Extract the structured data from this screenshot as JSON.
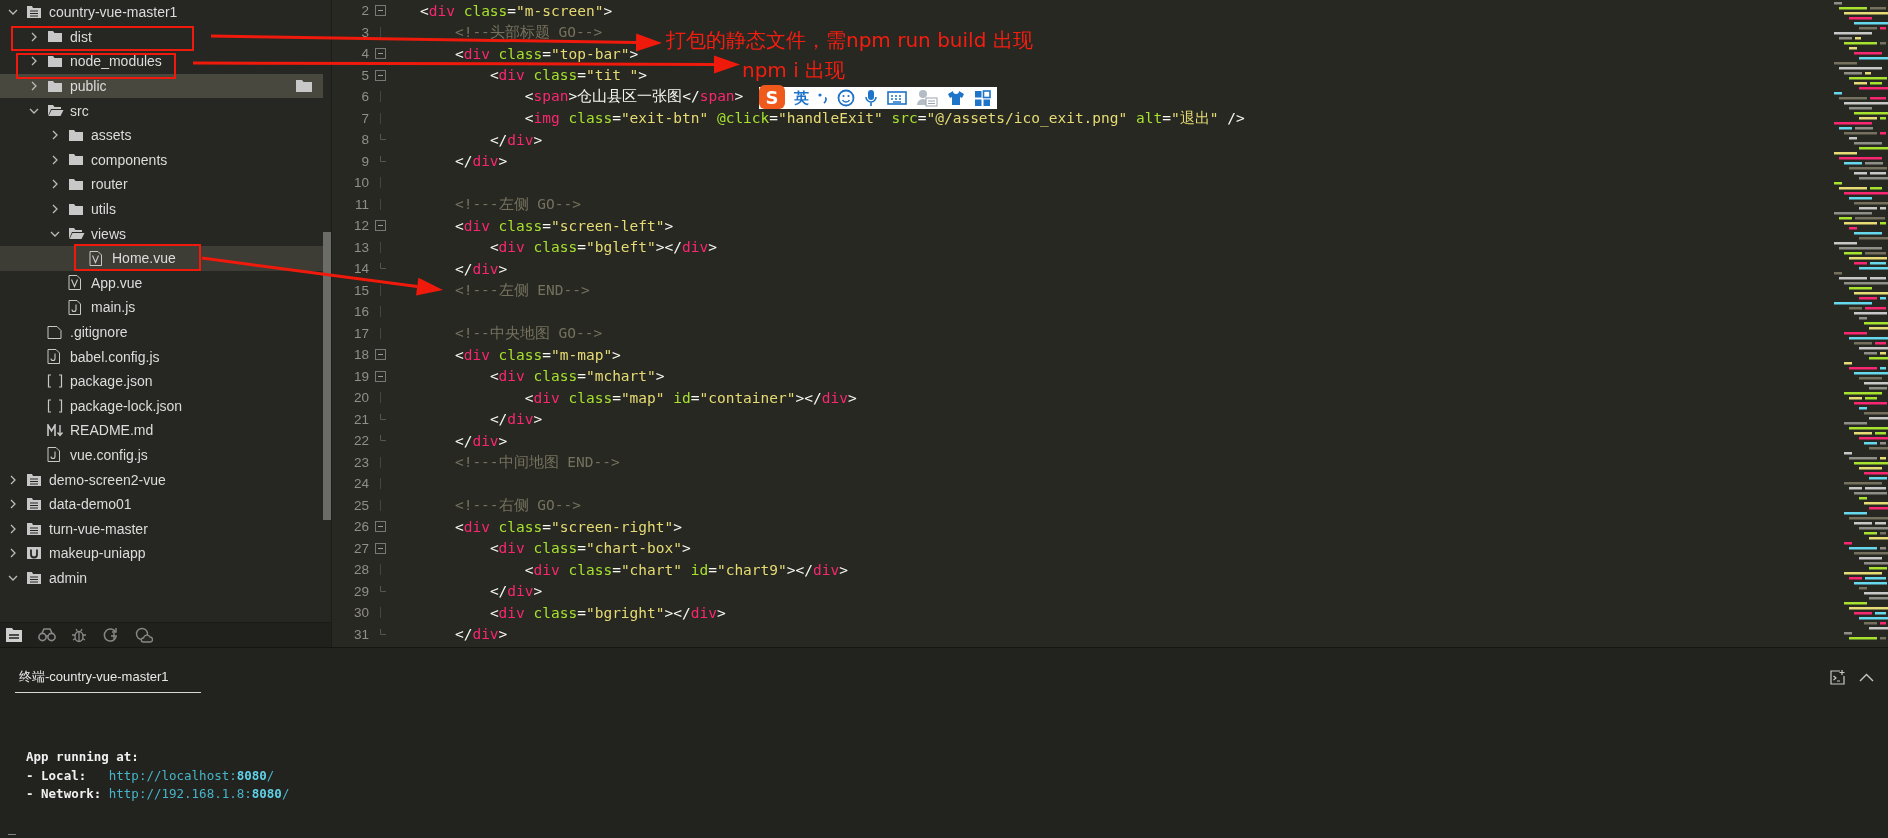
{
  "sidebar": {
    "tree": [
      {
        "name": "country-vue-master1",
        "kind": "project",
        "expanded": true,
        "selected": false,
        "hovered": false,
        "children": [
          {
            "name": "dist",
            "kind": "folder",
            "expanded": false,
            "selected": false,
            "hovered": false
          },
          {
            "name": "node_modules",
            "kind": "folder",
            "expanded": false,
            "selected": false,
            "hovered": false
          },
          {
            "name": "public",
            "kind": "folder",
            "expanded": false,
            "selected": false,
            "hovered": true
          },
          {
            "name": "src",
            "kind": "folder",
            "expanded": true,
            "selected": false,
            "hovered": false,
            "children": [
              {
                "name": "assets",
                "kind": "folder",
                "expanded": false,
                "selected": false,
                "hovered": false
              },
              {
                "name": "components",
                "kind": "folder",
                "expanded": false,
                "selected": false,
                "hovered": false
              },
              {
                "name": "router",
                "kind": "folder",
                "expanded": false,
                "selected": false,
                "hovered": false
              },
              {
                "name": "utils",
                "kind": "folder",
                "expanded": false,
                "selected": false,
                "hovered": false
              },
              {
                "name": "views",
                "kind": "folder",
                "expanded": true,
                "selected": false,
                "hovered": false,
                "children": [
                  {
                    "name": "Home.vue",
                    "kind": "vue",
                    "selected": true,
                    "hovered": false
                  }
                ]
              },
              {
                "name": "App.vue",
                "kind": "vue",
                "selected": false,
                "hovered": false
              },
              {
                "name": "main.js",
                "kind": "js",
                "selected": false,
                "hovered": false
              }
            ]
          },
          {
            "name": ".gitignore",
            "kind": "text",
            "selected": false,
            "hovered": false
          },
          {
            "name": "babel.config.js",
            "kind": "js",
            "selected": false,
            "hovered": false
          },
          {
            "name": "package.json",
            "kind": "json",
            "selected": false,
            "hovered": false
          },
          {
            "name": "package-lock.json",
            "kind": "json",
            "selected": false,
            "hovered": false
          },
          {
            "name": "README.md",
            "kind": "markdown",
            "selected": false,
            "hovered": false
          },
          {
            "name": "vue.config.js",
            "kind": "js",
            "selected": false,
            "hovered": false
          }
        ]
      },
      {
        "name": "demo-screen2-vue",
        "kind": "project",
        "expanded": false,
        "selected": false,
        "hovered": false
      },
      {
        "name": "data-demo01",
        "kind": "project",
        "expanded": false,
        "selected": false,
        "hovered": false
      },
      {
        "name": "turn-vue-master",
        "kind": "project",
        "expanded": false,
        "selected": false,
        "hovered": false
      },
      {
        "name": "makeup-uniapp",
        "kind": "uniapp",
        "expanded": false,
        "selected": false,
        "hovered": false
      },
      {
        "name": "admin",
        "kind": "project",
        "expanded": true,
        "selected": false,
        "hovered": false
      }
    ]
  },
  "editor": {
    "lines": [
      {
        "number": "2",
        "text": "<div class=\"m-screen\">",
        "collapsible": true,
        "block_end": false
      },
      {
        "number": "3",
        "text": "    <!--头部标题 GO-->",
        "collapsible": false,
        "block_end": false
      },
      {
        "number": "4",
        "text": "    <div class=\"top-bar\">",
        "collapsible": true,
        "block_end": false
      },
      {
        "number": "5",
        "text": "        <div class=\"tit \">",
        "collapsible": true,
        "block_end": false
      },
      {
        "number": "6",
        "text": "            <span>仓山县区一张图</span>",
        "collapsible": false,
        "block_end": false
      },
      {
        "number": "7",
        "text": "            <img class=\"exit-btn\" @click=\"handleExit\" src=\"@/assets/ico_exit.png\" alt=\"退出\" />",
        "collapsible": false,
        "block_end": false
      },
      {
        "number": "8",
        "text": "        </div>",
        "collapsible": false,
        "block_end": true
      },
      {
        "number": "9",
        "text": "    </div>",
        "collapsible": false,
        "block_end": true
      },
      {
        "number": "10",
        "collapsible": false,
        "block_end": false
      },
      {
        "number": "11",
        "text": "    <!---左侧 GO-->",
        "collapsible": false,
        "block_end": false
      },
      {
        "number": "12",
        "text": "    <div class=\"screen-left\">",
        "collapsible": true,
        "block_end": false
      },
      {
        "number": "13",
        "text": "        <div class=\"bgleft\"></div>",
        "collapsible": false,
        "block_end": false
      },
      {
        "number": "14",
        "text": "    </div>",
        "collapsible": false,
        "block_end": true
      },
      {
        "number": "15",
        "text": "    <!---左侧 END-->",
        "collapsible": false,
        "block_end": false
      },
      {
        "number": "16",
        "collapsible": false,
        "block_end": false
      },
      {
        "number": "17",
        "text": "    <!--中央地图 GO-->",
        "collapsible": false,
        "block_end": false
      },
      {
        "number": "18",
        "text": "    <div class=\"m-map\">",
        "collapsible": true,
        "block_end": false
      },
      {
        "number": "19",
        "text": "        <div class=\"mchart\">",
        "collapsible": true,
        "block_end": false
      },
      {
        "number": "20",
        "text": "            <div class=\"map\" id=\"container\"></div>",
        "collapsible": false,
        "block_end": false
      },
      {
        "number": "21",
        "text": "        </div>",
        "collapsible": false,
        "block_end": true
      },
      {
        "number": "22",
        "text": "    </div>",
        "collapsible": false,
        "block_end": true
      },
      {
        "number": "23",
        "text": "    <!---中间地图 END-->",
        "collapsible": false,
        "block_end": false
      },
      {
        "number": "24",
        "collapsible": false,
        "block_end": false
      },
      {
        "number": "25",
        "text": "    <!---右侧 GO-->",
        "collapsible": false,
        "block_end": false
      },
      {
        "number": "26",
        "text": "    <div class=\"screen-right\">",
        "collapsible": true,
        "block_end": false
      },
      {
        "number": "27",
        "text": "        <div class=\"chart-box\">",
        "collapsible": true,
        "block_end": false
      },
      {
        "number": "28",
        "text": "            <div class=\"chart\" id=\"chart9\"></div>",
        "collapsible": false,
        "block_end": false
      },
      {
        "number": "29",
        "text": "        </div>",
        "collapsible": false,
        "block_end": true
      },
      {
        "number": "30",
        "text": "        <div class=\"bgright\"></div>",
        "collapsible": false,
        "block_end": false
      },
      {
        "number": "31",
        "text": "    </div>",
        "collapsible": false,
        "block_end": true
      }
    ]
  },
  "ime_toolbar": {
    "logo": "S",
    "mode": "英"
  },
  "annotations": [
    {
      "text": "打包的静态文件，需npm run build 出现"
    },
    {
      "text": "npm i 出现"
    }
  ],
  "terminal": {
    "tabs": [
      {
        "label": "终端-country-vue-master1",
        "selected": true
      }
    ],
    "lines": [
      [
        {
          "kind": "label",
          "text": "App running at:"
        }
      ],
      [
        {
          "kind": "label",
          "text": "- Local:   "
        },
        {
          "kind": "url",
          "text": "http://localhost:"
        },
        {
          "kind": "port",
          "text": "8080"
        },
        {
          "kind": "url",
          "text": "/"
        }
      ],
      [
        {
          "kind": "label",
          "text": "- Network: "
        },
        {
          "kind": "url",
          "text": "http://192.168.1.8:"
        },
        {
          "kind": "port",
          "text": "8080"
        },
        {
          "kind": "url",
          "text": "/"
        }
      ]
    ],
    "cursor": "_"
  }
}
